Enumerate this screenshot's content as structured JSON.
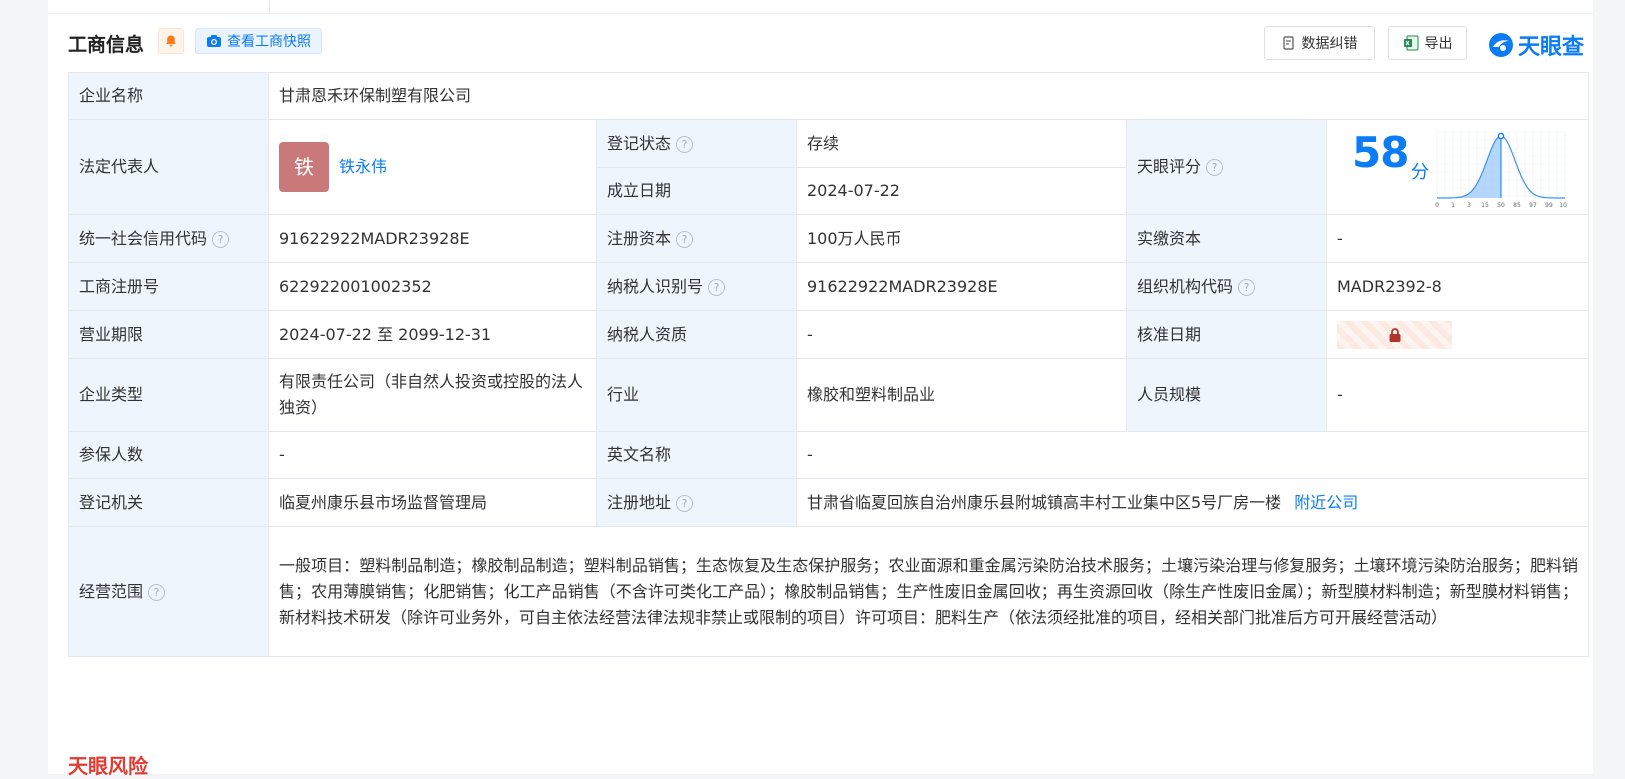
{
  "header": {
    "title": "工商信息",
    "snapshot_label": "查看工商快照",
    "correct_label": "数据纠错",
    "export_label": "导出",
    "logo_text": "天眼查"
  },
  "colors": {
    "accent": "#0b7cf5",
    "label_bg": "#eef5fd",
    "status_green": "#06a35a",
    "avatar_bg": "#c9797a"
  },
  "labels": {
    "company_name": "企业名称",
    "legal_rep": "法定代表人",
    "reg_status": "登记状态",
    "est_date": "成立日期",
    "tianyan_score": "天眼评分",
    "credit_code": "统一社会信用代码",
    "reg_capital": "注册资本",
    "paid_capital": "实缴资本",
    "reg_no": "工商注册号",
    "taxpayer_id": "纳税人识别号",
    "org_code": "组织机构代码",
    "business_term": "营业期限",
    "taxpayer_qual": "纳税人资质",
    "approval_date": "核准日期",
    "company_type": "企业类型",
    "industry": "行业",
    "staff_size": "人员规模",
    "insured_count": "参保人数",
    "english_name": "英文名称",
    "reg_authority": "登记机关",
    "reg_address": "注册地址",
    "business_scope": "经营范围"
  },
  "values": {
    "company_name": "甘肃恩禾环保制塑有限公司",
    "avatar_char": "铁",
    "legal_rep": "铁永伟",
    "reg_status": "存续",
    "est_date": "2024-07-22",
    "score": "58",
    "score_unit": "分",
    "credit_code": "91622922MADR23928E",
    "reg_capital": "100万人民币",
    "paid_capital": "-",
    "reg_no": "622922001002352",
    "taxpayer_id": "91622922MADR23928E",
    "org_code": "MADR2392-8",
    "business_term": "2024-07-22 至 2099-12-31",
    "taxpayer_qual": "-",
    "company_type": "有限责任公司（非自然人投资或控股的法人独资）",
    "industry": "橡胶和塑料制品业",
    "staff_size": "-",
    "insured_count": "-",
    "english_name": "-",
    "reg_authority": "临夏州康乐县市场监督管理局",
    "reg_address": "甘肃省临夏回族自治州康乐县附城镇高丰村工业集中区5号厂房一楼",
    "nearby_link": "附近公司",
    "business_scope": "一般项目：塑料制品制造；橡胶制品制造；塑料制品销售；生态恢复及生态保护服务；农业面源和重金属污染防治技术服务；土壤污染治理与修复服务；土壤环境污染防治服务；肥料销售；农用薄膜销售；化肥销售；化工产品销售（不含许可类化工产品）；橡胶制品销售；生产性废旧金属回收；再生资源回收（除生产性废旧金属）；新型膜材料制造；新型膜材料销售；新材料技术研发（除许可业务外，可自主依法经营法律法规非禁止或限制的项目）许可项目：肥料生产（依法须经批准的项目，经相关部门批准后方可开展经营活动）"
  },
  "score_chart": {
    "x_ticks": [
      "0",
      "1",
      "3",
      "15",
      "50",
      "85",
      "97",
      "99",
      "100"
    ],
    "marker_at_tick": "50"
  },
  "bottom_section_title": "天眼风险"
}
